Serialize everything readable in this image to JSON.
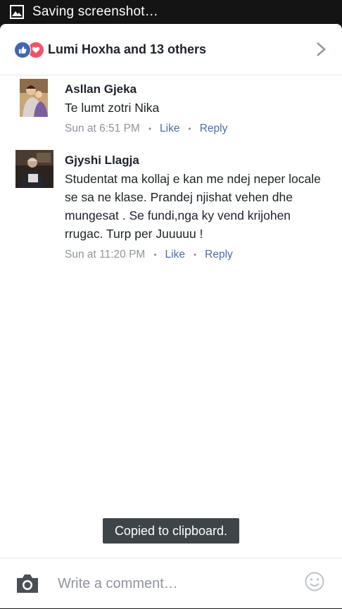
{
  "statusbar": {
    "text": "Saving screenshot…",
    "icon": "image-icon"
  },
  "header": {
    "title": "Lumi Hoxha and 13 others",
    "like_color": "#4267b2",
    "love_color": "#f25268"
  },
  "comments": [
    {
      "author": "Asllan Gjeka",
      "text": "Te lumt zotri Nika",
      "time": "Sun at 6:51 PM",
      "like": "Like",
      "reply": "Reply"
    },
    {
      "author": "Gjyshi Llagja",
      "text": "Studentat ma kollaj e kan me ndej neper locale se sa ne klase. Prandej njishat vehen dhe mungesat . Se fundi,nga ky vend krijohen rrugac. Turp per Juuuuu !",
      "time": "Sun at 11:20 PM",
      "like": "Like",
      "reply": "Reply"
    }
  ],
  "toast": {
    "text": "Copied to clipboard."
  },
  "composer": {
    "placeholder": "Write a comment…"
  },
  "colors": {
    "link": "#4b6cab",
    "meta": "#90949c",
    "text": "#1d2129"
  }
}
